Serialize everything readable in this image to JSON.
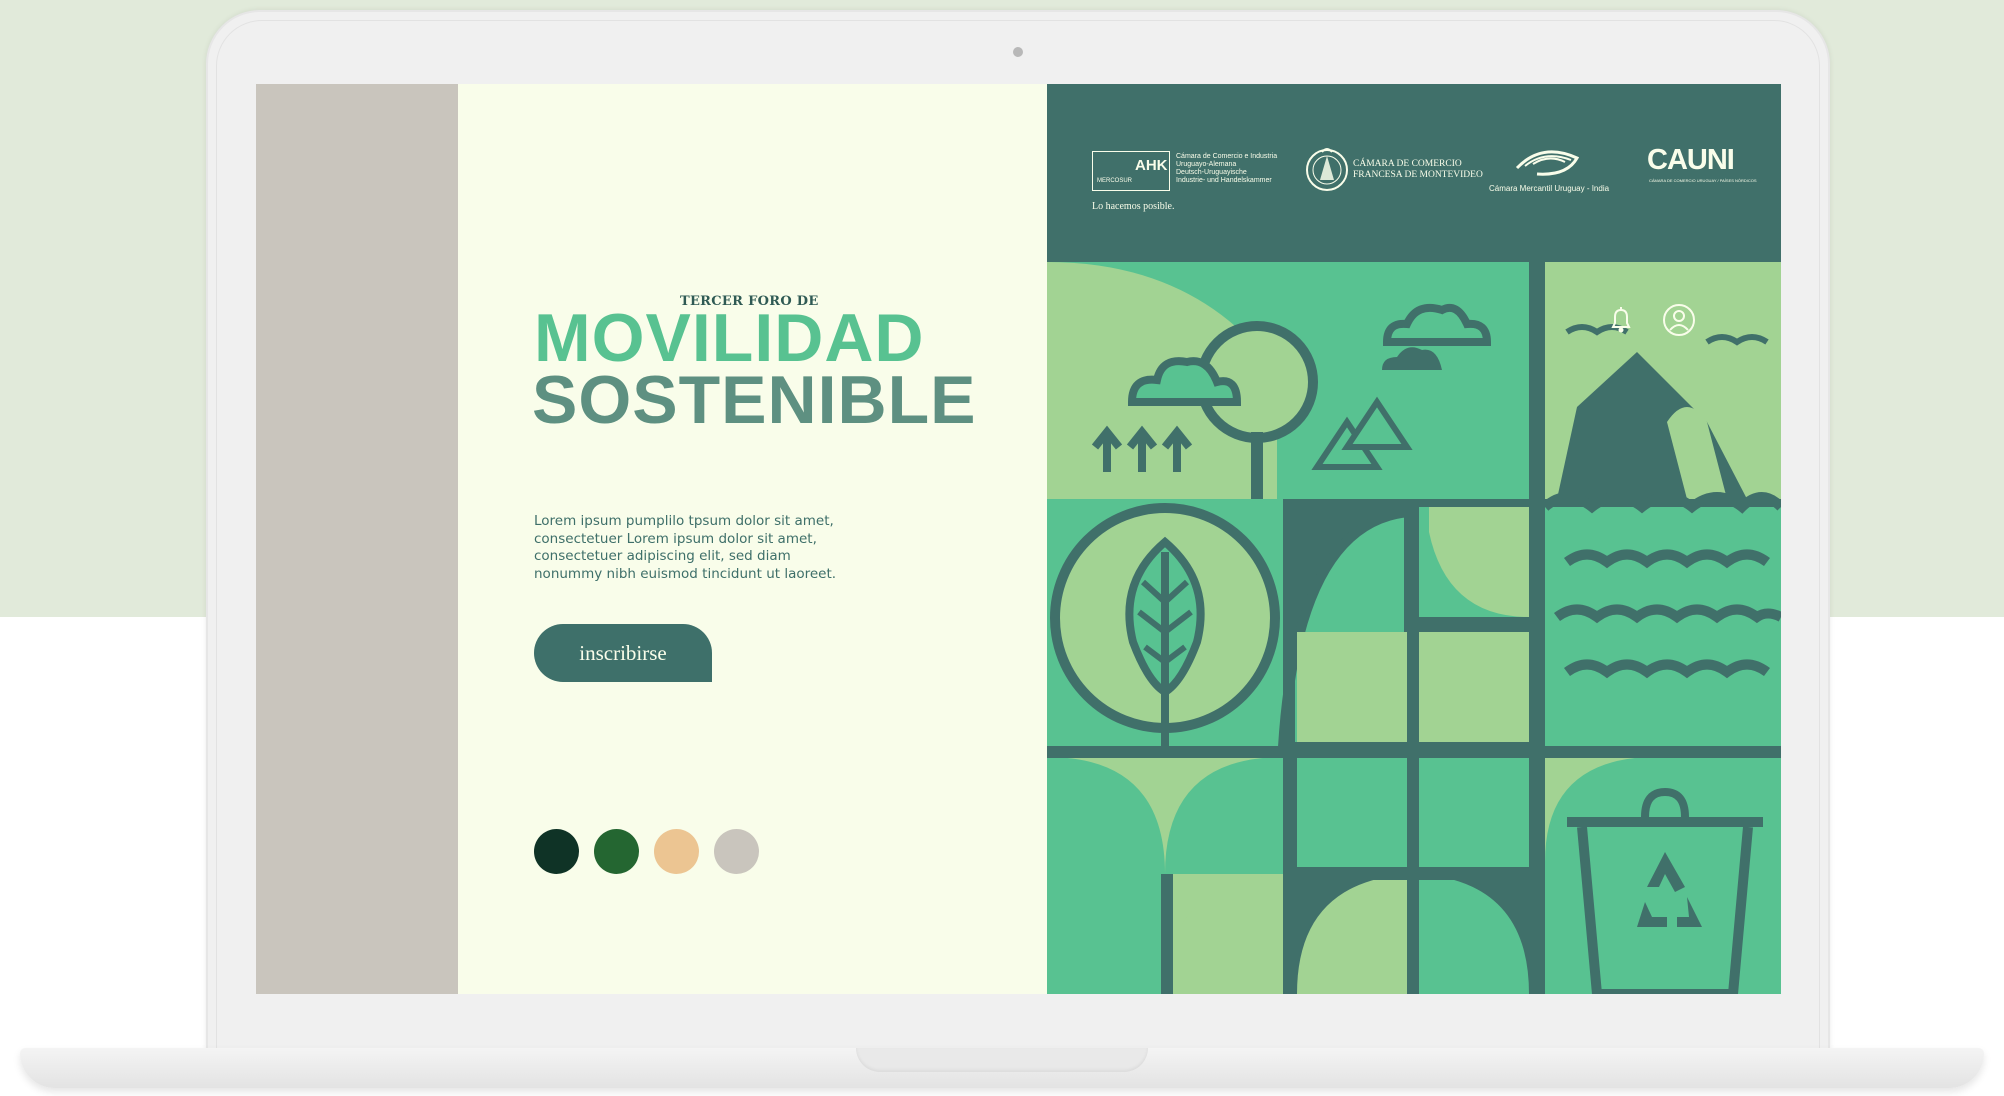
{
  "hero": {
    "forum_prefix": "TERCER FORO DE",
    "title_line1": "MOVILIDAD",
    "title_line2": "SOSTENIBLE",
    "description": "Lorem ipsum pumplilo tpsum dolor sit amet, consectetuer Lorem ipsum dolor sit amet, consectetuer adipiscing elit, sed diam nonummy nibh euismod tincidunt ut laoreet.",
    "cta_label": "inscribirse"
  },
  "palette": [
    "#0f3326",
    "#246631",
    "#ecc592",
    "#c9c5bd"
  ],
  "sponsors": {
    "ahk": {
      "wordmark": "AHK",
      "region": "MERCOSUR",
      "lines": [
        "Cámara de Comercio e Industria",
        "Uruguayo-Alemana",
        "Deutsch-Uruguayische",
        "Industrie- und Handelskammer"
      ],
      "tagline": "Lo hacemos posible."
    },
    "french": {
      "lines": [
        "CÁMARA DE COMERCIO",
        "FRANCESA DE MONTEVIDEO"
      ]
    },
    "india": {
      "name": "Cámara Mercantil Uruguay - India"
    },
    "cauni": {
      "wordmark": "CAUNI",
      "sub": "CÁMARA DE COMERCIO URUGUAY / PAÍSES NÓRDICOS"
    }
  },
  "icons": {
    "notifications": "bell-icon",
    "profile": "user-icon"
  },
  "colors": {
    "dark_teal": "#40706a",
    "mint": "#58c291",
    "light_green": "#a2d393",
    "cream": "#f9fdea",
    "sidebar_gray": "#c9c5bd",
    "background_green": "#e1eada"
  }
}
